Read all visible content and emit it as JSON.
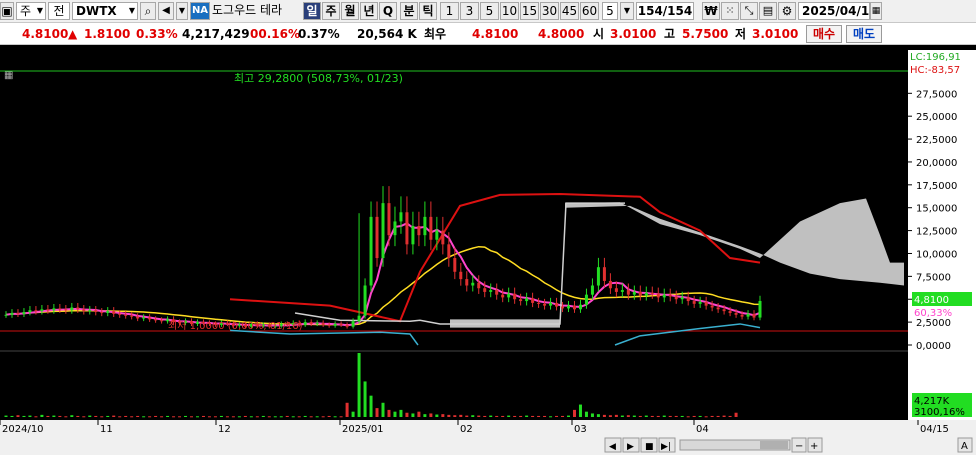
{
  "toolbar": {
    "market": "주",
    "period_type": "전",
    "symbol": "DWTX",
    "name_badge": "NA",
    "company": "도그우드 테라",
    "period_buttons": [
      "일",
      "주",
      "월",
      "년",
      "Q",
      "분",
      "틱"
    ],
    "intervals": [
      "1",
      "3",
      "5",
      "10",
      "15",
      "30",
      "45",
      "60"
    ],
    "interval_value": "5",
    "bar_count": "154/154",
    "date": "2025/04/1"
  },
  "quote": {
    "price": "4.8100",
    "arrow": "▲",
    "change": "1.8100",
    "change_pct": "0.33%",
    "volume": "4,217,429",
    "vol_pct_a": "00.16%",
    "vol_pct_b": "0.37%",
    "amount": "20,564 K",
    "best_label": "최우",
    "best_ask": "4.8100",
    "best_bid": "4.8000",
    "open_label": "시",
    "open": "3.0100",
    "high_label": "고",
    "high": "5.7500",
    "low_label": "저",
    "low": "3.0100",
    "buy_label": "매수",
    "sell_label": "매도"
  },
  "chart_data": {
    "type": "candlestick",
    "price_axis": {
      "ticks": [
        "27,5000",
        "25,0000",
        "22,5000",
        "20,0000",
        "17,5000",
        "15,0000",
        "12,5000",
        "10,0000",
        "7,5000",
        "5,0000",
        "2,5000",
        "0,0000"
      ],
      "ylim": [
        0,
        29.5
      ]
    },
    "date_axis": [
      "2024/10",
      "11",
      "12",
      "2025/01",
      "02",
      "03",
      "04",
      "04/15"
    ],
    "annotation_high": "최고 29,2800 (508,73%, 01/23)",
    "annotation_low": "최저 1,0000 (0,00%, 01/16)",
    "legend_lc": "LC:196,91",
    "legend_hc": "HC:-83,57",
    "last_price": "4,8100",
    "last_pct": "60,33%",
    "volume_label": "4,217K",
    "volume_pct": "3100,16%",
    "colors": {
      "up": "#22dd22",
      "down": "#e03030",
      "ma_short": "#ff44cc",
      "ma_mid": "#ffdd22",
      "ma_long": "#dd1111",
      "ma_alt": "#3ab0d0",
      "cloud": "#c0c0c0"
    },
    "closes": [
      3.3,
      3.5,
      3.4,
      3.6,
      3.8,
      3.7,
      3.9,
      3.8,
      4.0,
      3.9,
      3.8,
      4.1,
      3.9,
      3.7,
      3.8,
      3.6,
      3.5,
      3.7,
      3.4,
      3.3,
      3.2,
      3.1,
      2.9,
      3.0,
      2.8,
      2.7,
      2.6,
      2.8,
      2.5,
      2.4,
      2.6,
      2.3,
      2.5,
      2.4,
      2.3,
      2.2,
      2.4,
      2.3,
      2.1,
      2.2,
      2.0,
      2.3,
      2.1,
      2.2,
      2.0,
      2.1,
      2.3,
      2.2,
      2.4,
      2.2,
      2.5,
      2.3,
      2.4,
      2.2,
      2.1,
      2.3,
      2.2,
      2.0,
      2.6,
      3.2,
      6.5,
      14.0,
      9.5,
      15.5,
      12.0,
      13.5,
      14.5,
      11.0,
      13.0,
      12.0,
      14.0,
      11.5,
      12.5,
      11.0,
      9.5,
      8.0,
      7.2,
      6.5,
      6.8,
      6.2,
      5.8,
      6.0,
      5.5,
      5.2,
      5.6,
      5.0,
      4.8,
      5.1,
      4.6,
      4.5,
      4.3,
      4.6,
      4.2,
      4.0,
      4.3,
      3.9,
      4.4,
      5.5,
      6.5,
      8.5,
      7.0,
      6.2,
      5.8,
      6.0,
      5.5,
      5.8,
      5.4,
      5.7,
      5.6,
      5.2,
      5.5,
      5.3,
      5.0,
      5.2,
      4.8,
      4.5,
      4.7,
      4.3,
      4.1,
      3.9,
      3.7,
      3.5,
      3.3,
      3.1,
      3.4,
      3.0,
      4.81
    ],
    "volumes": [
      0.4,
      0.3,
      0.5,
      0.3,
      0.4,
      0.2,
      0.6,
      0.3,
      0.4,
      0.3,
      0.2,
      0.5,
      0.3,
      0.2,
      0.4,
      0.3,
      0.2,
      0.3,
      0.4,
      0.2,
      0.3,
      0.2,
      0.3,
      0.2,
      0.2,
      0.3,
      0.2,
      0.3,
      0.2,
      0.2,
      0.3,
      0.2,
      0.2,
      0.3,
      0.2,
      0.2,
      0.3,
      0.2,
      0.2,
      0.2,
      0.3,
      0.2,
      0.2,
      0.3,
      0.2,
      0.2,
      0.2,
      0.3,
      0.2,
      0.2,
      0.3,
      0.2,
      0.2,
      0.2,
      0.3,
      0.2,
      0.2,
      4.0,
      1.5,
      18.0,
      10.0,
      6.0,
      2.5,
      4.0,
      2.0,
      1.5,
      2.0,
      1.2,
      1.0,
      1.5,
      0.8,
      1.0,
      0.7,
      0.8,
      0.6,
      0.5,
      0.6,
      0.4,
      0.5,
      0.4,
      0.3,
      0.4,
      0.3,
      0.3,
      0.4,
      0.3,
      0.3,
      0.4,
      0.3,
      0.3,
      0.3,
      0.2,
      0.3,
      0.3,
      0.4,
      2.0,
      3.5,
      1.5,
      1.0,
      0.8,
      0.6,
      0.5,
      0.6,
      0.4,
      0.5,
      0.4,
      0.3,
      0.4,
      0.3,
      0.3,
      0.4,
      0.3,
      0.3,
      0.3,
      0.2,
      0.3,
      0.3,
      0.2,
      0.3,
      0.3,
      0.4,
      0.3,
      1.2
    ]
  }
}
